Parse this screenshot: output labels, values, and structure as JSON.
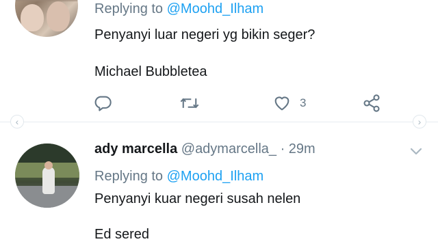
{
  "tweet1": {
    "replying_prefix": "Replying to ",
    "replying_handle": "@Moohd_Ilham",
    "line1": "Penyanyi luar negeri yg bikin seger?",
    "line2": "Michael Bubbletea",
    "like_count": "3",
    "icons": [
      "reply-icon",
      "retweet-icon",
      "like-icon",
      "share-icon"
    ]
  },
  "tweet2": {
    "display_name": "ady marcella",
    "meta": " @adymarcella_ · 29m",
    "replying_prefix": "Replying to ",
    "replying_handle": "@Moohd_Ilham",
    "line1": "Penyanyi kuar negeri susah nelen",
    "line2": "Ed sered"
  },
  "colors": {
    "link": "#1da1f2",
    "secondary_text": "#657786",
    "primary_text": "#14171a",
    "divider": "#e6ecf0"
  }
}
